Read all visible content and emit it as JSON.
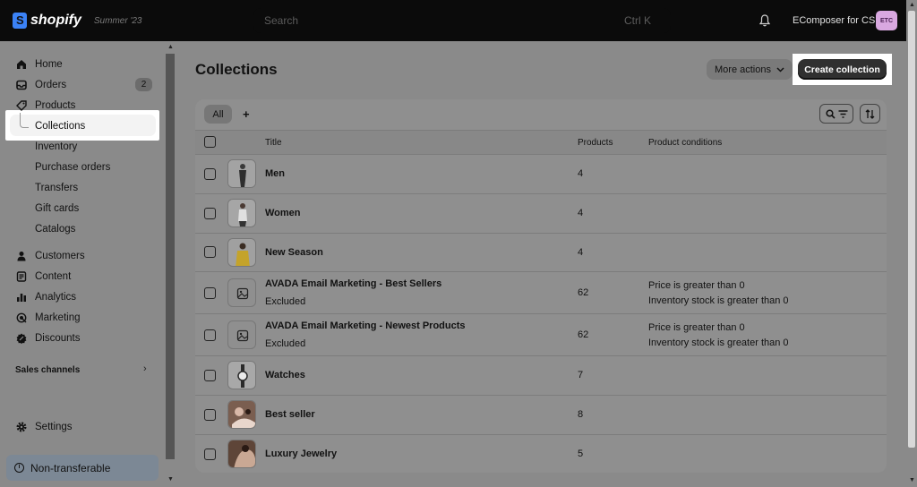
{
  "topbar": {
    "brand": "shopify",
    "edition": "Summer '23",
    "search_placeholder": "Search",
    "search_shortcut": "Ctrl K",
    "store_name": "EComposer for CS",
    "store_initials": "ETC"
  },
  "sidebar": {
    "items": [
      {
        "label": "Home",
        "icon": "home-icon"
      },
      {
        "label": "Orders",
        "icon": "orders-icon",
        "badge": "2"
      },
      {
        "label": "Products",
        "icon": "tag-icon"
      },
      {
        "label": "Collections"
      },
      {
        "label": "Inventory"
      },
      {
        "label": "Purchase orders"
      },
      {
        "label": "Transfers"
      },
      {
        "label": "Gift cards"
      },
      {
        "label": "Catalogs"
      },
      {
        "label": "Customers",
        "icon": "person-icon"
      },
      {
        "label": "Content",
        "icon": "content-icon"
      },
      {
        "label": "Analytics",
        "icon": "analytics-icon"
      },
      {
        "label": "Marketing",
        "icon": "marketing-icon"
      },
      {
        "label": "Discounts",
        "icon": "discount-icon"
      }
    ],
    "sales_channels": "Sales channels",
    "settings": "Settings",
    "non_transferable": "Non-transferable"
  },
  "main": {
    "title": "Collections",
    "more_actions": "More actions",
    "create_collection": "Create collection",
    "tabs": {
      "all": "All",
      "add": "+"
    },
    "columns": {
      "title": "Title",
      "products": "Products",
      "conditions": "Product conditions"
    },
    "rows": [
      {
        "title": "Men",
        "subtitle": "",
        "products": "4",
        "conditions": [
          "",
          ""
        ]
      },
      {
        "title": "Women",
        "subtitle": "",
        "products": "4",
        "conditions": [
          "",
          ""
        ]
      },
      {
        "title": "New Season",
        "subtitle": "",
        "products": "4",
        "conditions": [
          "",
          ""
        ]
      },
      {
        "title": "AVADA Email Marketing - Best Sellers",
        "subtitle": "Excluded",
        "products": "62",
        "conditions": [
          "Price is greater than 0",
          "Inventory stock is greater than 0"
        ]
      },
      {
        "title": "AVADA Email Marketing - Newest Products",
        "subtitle": "Excluded",
        "products": "62",
        "conditions": [
          "Price is greater than 0",
          "Inventory stock is greater than 0"
        ]
      },
      {
        "title": "Watches",
        "subtitle": "",
        "products": "7",
        "conditions": [
          "",
          ""
        ]
      },
      {
        "title": "Best seller",
        "subtitle": "",
        "products": "8",
        "conditions": [
          "",
          ""
        ]
      },
      {
        "title": "Luxury Jewelry",
        "subtitle": "",
        "products": "5",
        "conditions": [
          "",
          ""
        ]
      }
    ]
  },
  "colors": {
    "accent": "#303030",
    "overlay": "#8a8a8a",
    "topbar": "#0b0b0b"
  }
}
